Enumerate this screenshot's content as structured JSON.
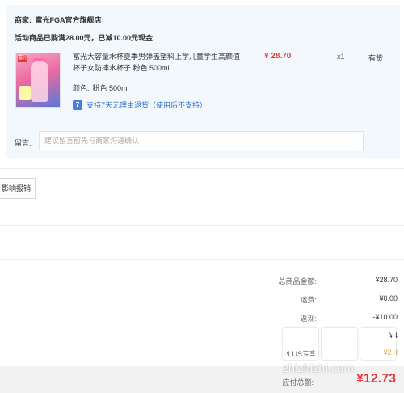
{
  "store": {
    "seller_label": "商家:",
    "seller_name": "富光FGA官方旗舰店",
    "promo": "活动商品已购满28.00元，已减10.00元现金"
  },
  "product": {
    "thumb_badge": "富光",
    "title": "富光大容量水杯夏季男弹盖塑料上学儿童学生高颜值杯子女防摔水杯子 粉色 500ml",
    "price": "¥ 28.70",
    "qty": "x1",
    "stock": "有货",
    "color_label": "颜色:",
    "color_value": "粉色 500ml",
    "return_icon": "7",
    "return_text": "支持7天无理由退货（使用后不支持）"
  },
  "note": {
    "label": "留言:",
    "placeholder": "建议留言前先与商家沟通确认"
  },
  "influence_button": "影响报销",
  "summary": [
    {
      "label": "总商品金额:",
      "value": "¥28.70"
    },
    {
      "label": "运费:",
      "value": "¥0.00"
    },
    {
      "label": "返现:",
      "value": "-¥10.00"
    },
    {
      "label": "",
      "value": "-¥4"
    },
    {
      "label": "PLUS专享",
      "value": "¥2.8"
    }
  ],
  "payable": {
    "label": "应付总额:",
    "value": "¥12.73"
  },
  "watermark": {
    "text": "zhizhizhi.com"
  },
  "colors": {
    "accent_red": "#e4393c",
    "link_blue": "#2a6dc8",
    "panel_bg": "#f3f8fc"
  }
}
